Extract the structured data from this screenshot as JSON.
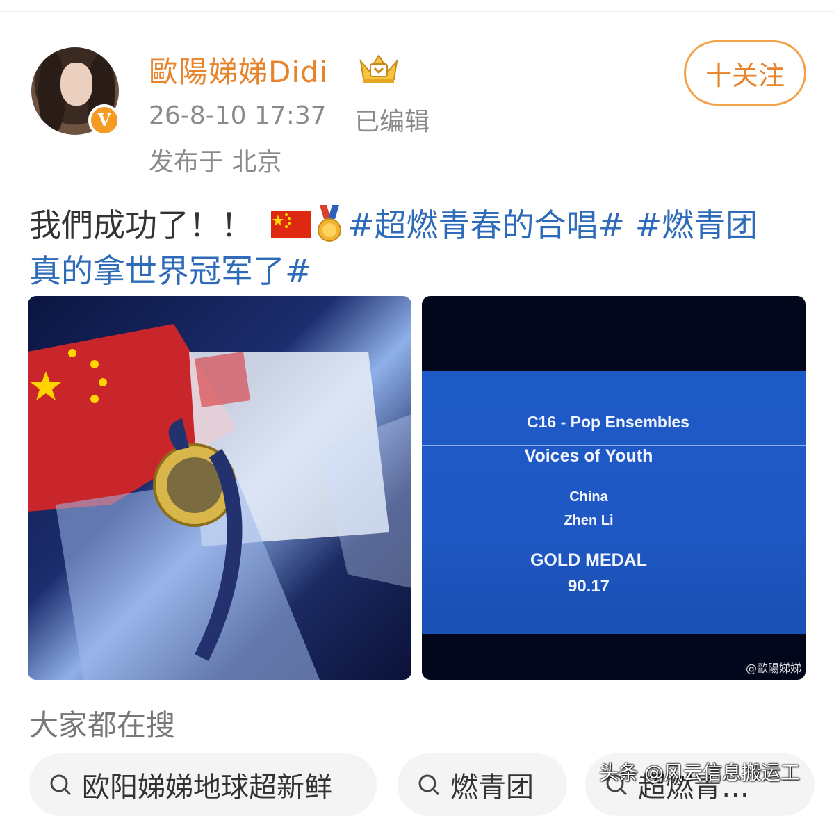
{
  "user": {
    "name": "歐陽娣娣Didi",
    "verified_mark": "V",
    "crown_icon": "crown-icon"
  },
  "meta": {
    "time": "26-8-10 17:37",
    "edited": "已编辑",
    "location": "发布于 北京"
  },
  "follow_button": {
    "label": "十关注"
  },
  "post": {
    "text": "我們成功了！！",
    "hashtag1": "#超燃青春的合唱#",
    "hashtag2": "#燃青团",
    "hashtag2_cont": "真的拿世界冠军了#"
  },
  "images": {
    "right_screen": {
      "category": "C16 - Pop Ensembles",
      "team": "Voices of Youth",
      "country": "China",
      "conductor": "Zhen Li",
      "medal": "GOLD MEDAL",
      "score": "90.17",
      "watermark": "@歐陽娣娣"
    }
  },
  "search": {
    "title": "大家都在搜",
    "chips": [
      "欧阳娣娣地球超新鲜",
      "燃青团",
      "超燃青…"
    ]
  },
  "overlay_watermark": "头条 @风云信息搬运工",
  "colors": {
    "accent": "#e8822b",
    "link": "#2e6bb8",
    "meta": "#8a8a8a"
  }
}
